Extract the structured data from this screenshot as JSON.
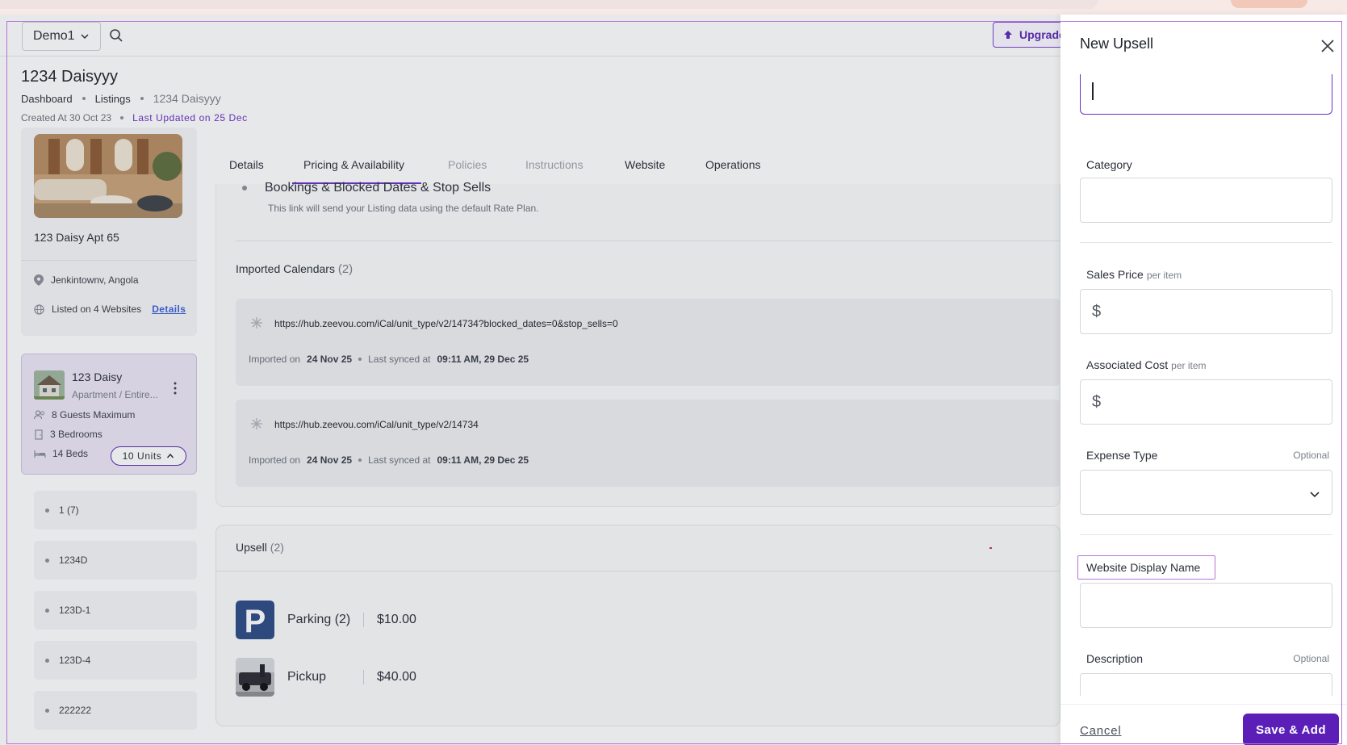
{
  "header": {
    "account_select": "Demo1",
    "upgrade_label": "Upgrade"
  },
  "listing": {
    "title": "1234 Daisyyy",
    "breadcrumb": [
      "Dashboard",
      "Listings",
      "1234 Daisyyy"
    ],
    "created": "Created At 30 Oct 23",
    "updated": "Last Updated on 25 Dec"
  },
  "sidebar": {
    "name": "123 Daisy Apt 65",
    "location": "Jenkintownv, Angola",
    "websites": "Listed on 4 Websites",
    "details_link": "Details",
    "unit": {
      "title": "123 Daisy",
      "subtitle": "Apartment / Entire...",
      "guests": "8 Guests Maximum",
      "bedrooms": "3 Bedrooms",
      "beds": "14 Beds",
      "units_button": "10 Units"
    },
    "subunits": [
      "1 (7)",
      "1234D",
      "123D-1",
      "123D-4",
      "222222"
    ]
  },
  "tabs": [
    {
      "label": "Details",
      "disabled": false
    },
    {
      "label": "Pricing & Availability",
      "disabled": false,
      "active": true
    },
    {
      "label": "Policies",
      "disabled": true
    },
    {
      "label": "Instructions",
      "disabled": true
    },
    {
      "label": "Website",
      "disabled": false
    },
    {
      "label": "Operations",
      "disabled": false
    }
  ],
  "sync": {
    "bullet_title": "Bookings & Blocked Dates & Stop Sells",
    "bullet_note": "This link will send your Listing data using the default Rate Plan.",
    "imported_title": "Imported Calendars",
    "imported_count": "(2)",
    "calendars": [
      {
        "url": "https://hub.zeevou.com/iCal/unit_type/v2/14734?blocked_dates=0&stop_sells=0",
        "imported_prefix": "Imported on",
        "imported_date": "24 Nov 25",
        "synced_prefix": "Last synced at",
        "synced_time": "09:11 AM, 29 Dec 25"
      },
      {
        "url": "https://hub.zeevou.com/iCal/unit_type/v2/14734",
        "imported_prefix": "Imported on",
        "imported_date": "24 Nov 25",
        "synced_prefix": "Last synced at",
        "synced_time": "09:11 AM, 29 Dec 25"
      }
    ]
  },
  "upsell": {
    "title": "Upsell",
    "count": "(2)",
    "items": [
      {
        "name": "Parking (2)",
        "price": "$10.00",
        "icon": "parking-icon"
      },
      {
        "name": "Pickup",
        "price": "$40.00",
        "icon": "pickup-photo"
      }
    ]
  },
  "drawer": {
    "title": "New Upsell",
    "category_label": "Category",
    "sales_price_label": "Sales Price",
    "sales_price_suffix": "per item",
    "associated_cost_label": "Associated Cost",
    "associated_cost_suffix": "per item",
    "currency": "$",
    "expense_type_label": "Expense Type",
    "optional": "Optional",
    "website_display_name_label": "Website Display Name",
    "description_label": "Description",
    "cancel": "Cancel",
    "save": "Save & Add"
  },
  "colors": {
    "accent": "#6a2fc9",
    "save_button": "#5b1fb8",
    "link": "#3c62d8"
  }
}
